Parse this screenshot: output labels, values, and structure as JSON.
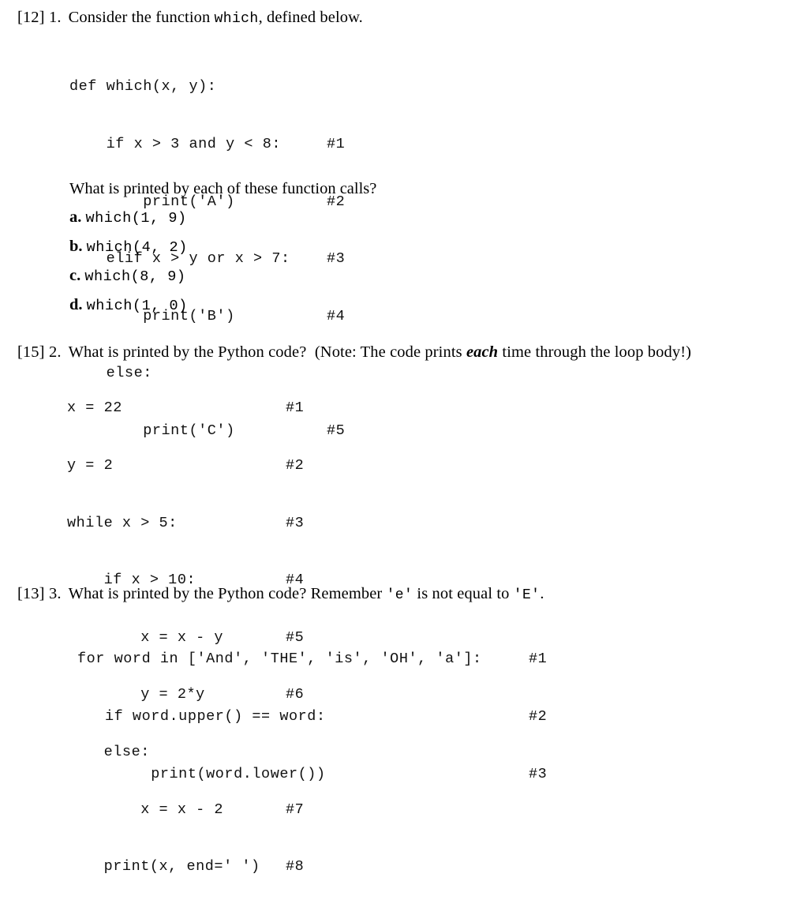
{
  "document": {
    "background_color": "#ffffff",
    "text_color": "#000000"
  },
  "questions": [
    {
      "marks": "[12]",
      "number": "1.",
      "header_pre": "Consider the function",
      "header_mono": "which",
      "header_post": ", defined below.",
      "code": [
        {
          "src": "def which(x, y):",
          "cmt": ""
        },
        {
          "src": "    if x > 3 and y < 8:",
          "cmt": "#1"
        },
        {
          "src": "        print('A')",
          "cmt": "#2"
        },
        {
          "src": "    elif x > y or x > 7:",
          "cmt": "#3"
        },
        {
          "src": "        print('B')",
          "cmt": "#4"
        },
        {
          "src": "    else:",
          "cmt": ""
        },
        {
          "src": "        print('C')",
          "cmt": "#5"
        }
      ],
      "prompt": "What is printed by each of these function calls?",
      "items": [
        {
          "label": "a.",
          "call": "which(1, 9)"
        },
        {
          "label": "b.",
          "call": "which(4, 2)"
        },
        {
          "label": "c.",
          "call": "which(8, 9)"
        },
        {
          "label": "d.",
          "call": " which(1, 0)"
        }
      ]
    },
    {
      "marks": "[15]",
      "number": "2.",
      "header_pre": "What is printed by the Python code?",
      "note_pre": "(Note:  The code prints ",
      "note_em": "each",
      "note_post": " time through the loop body!)",
      "code": [
        {
          "src": "x = 22",
          "cmt": "#1"
        },
        {
          "src": "y = 2",
          "cmt": "#2"
        },
        {
          "src": "while x > 5:",
          "cmt": "#3"
        },
        {
          "src": "    if x > 10:",
          "cmt": "#4"
        },
        {
          "src": "        x = x - y",
          "cmt": "#5"
        },
        {
          "src": "        y = 2*y",
          "cmt": "#6"
        },
        {
          "src": "    else:",
          "cmt": ""
        },
        {
          "src": "        x = x - 2",
          "cmt": "#7"
        },
        {
          "src": "    print(x, end=' ')",
          "cmt": "#8"
        }
      ]
    },
    {
      "marks": "[13]",
      "number": "3.",
      "header_pre": "What is printed by the Python code?  Remember ",
      "header_mono_a": "'e'",
      "header_mid": " is not equal to ",
      "header_mono_b": "'E'",
      "header_post": ".",
      "code": [
        {
          "src": "for word in ['And', 'THE', 'is', 'OH', 'a']:",
          "cmt": "#1"
        },
        {
          "src": "   if word.upper() == word:",
          "cmt": "#2"
        },
        {
          "src": "        print(word.lower())",
          "cmt": "#3"
        }
      ]
    }
  ]
}
